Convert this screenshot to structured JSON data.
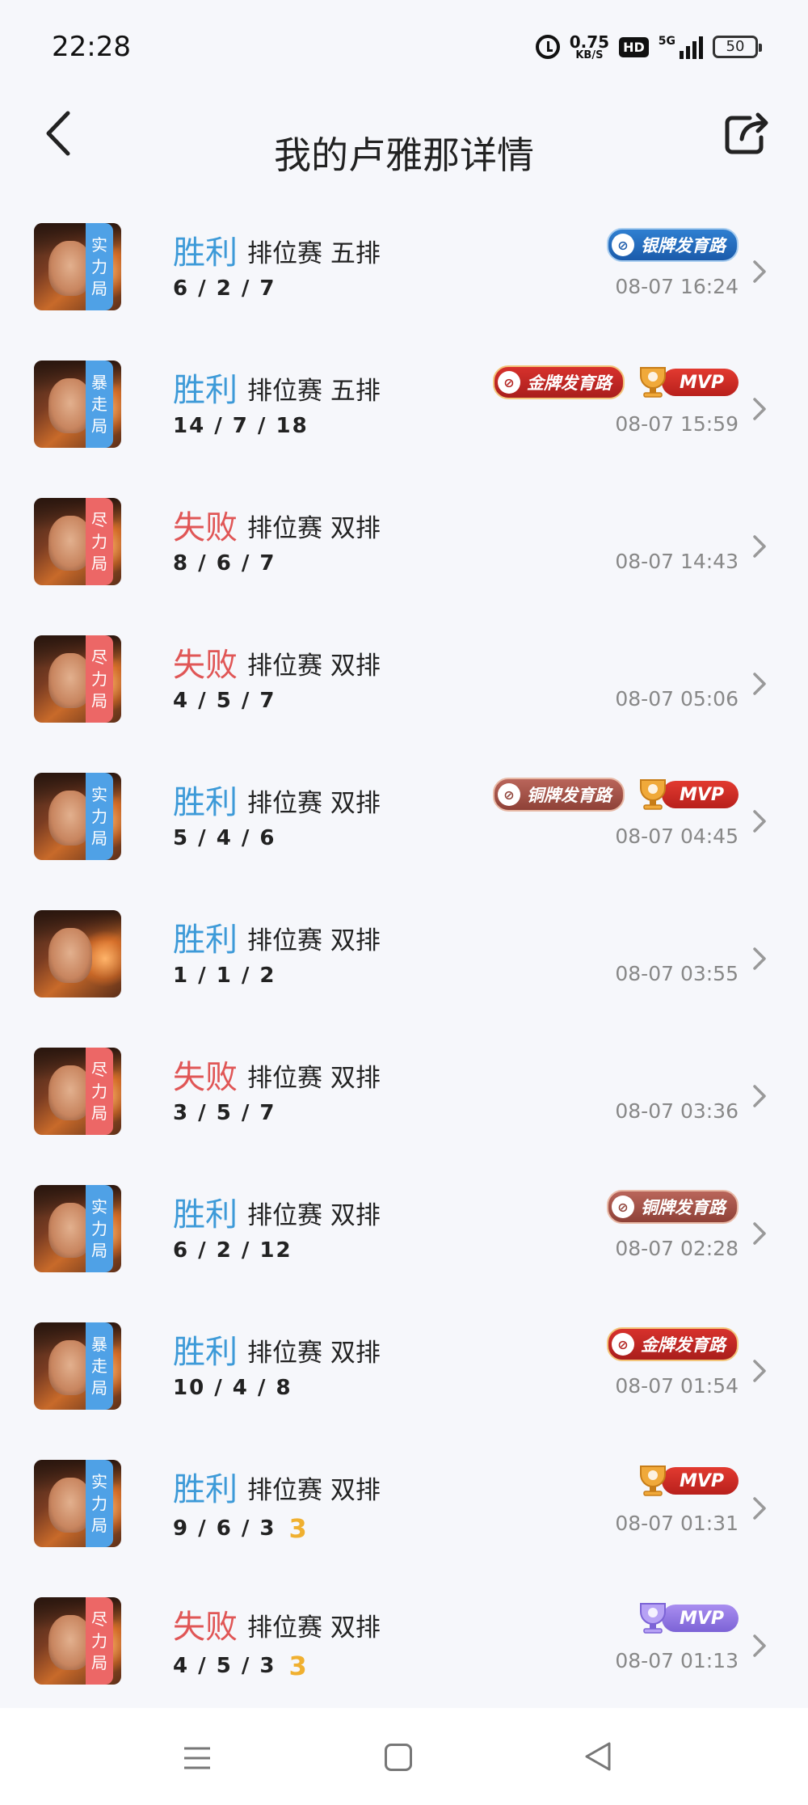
{
  "status": {
    "time": "22:28",
    "speed_value": "0.75",
    "speed_unit": "KB/S",
    "hd": "HD",
    "network": "5G",
    "battery": "50"
  },
  "header": {
    "title": "我的卢雅那详情"
  },
  "icons": {
    "back": "chevron-left-icon",
    "share": "share-icon",
    "row_arrow": "chevron-right-icon",
    "cup": "trophy-icon"
  },
  "colors": {
    "win": "#3d9ad8",
    "loss": "#e05656",
    "tag_blue": "#4fa1e6",
    "tag_red": "#ec6766",
    "extra_number": "#f0b030"
  },
  "matches": [
    {
      "tag": [
        "实",
        "力",
        "局"
      ],
      "tag_color": "blue",
      "result": "胜利",
      "win": true,
      "mode": "排位赛 五排",
      "kda": "6 / 2 / 7",
      "extra": "",
      "badge": {
        "label": "银牌发育路",
        "type": "silver"
      },
      "mvp": null,
      "time": "08-07 16:24"
    },
    {
      "tag": [
        "暴",
        "走",
        "局"
      ],
      "tag_color": "blue",
      "result": "胜利",
      "win": true,
      "mode": "排位赛 五排",
      "kda": "14 / 7 / 18",
      "extra": "",
      "badge": {
        "label": "金牌发育路",
        "type": "gold"
      },
      "mvp": {
        "label": "MVP",
        "type": "red"
      },
      "time": "08-07 15:59"
    },
    {
      "tag": [
        "尽",
        "力",
        "局"
      ],
      "tag_color": "red",
      "result": "失败",
      "win": false,
      "mode": "排位赛 双排",
      "kda": "8 / 6 / 7",
      "extra": "",
      "badge": null,
      "mvp": null,
      "time": "08-07 14:43"
    },
    {
      "tag": [
        "尽",
        "力",
        "局"
      ],
      "tag_color": "red",
      "result": "失败",
      "win": false,
      "mode": "排位赛 双排",
      "kda": "4 / 5 / 7",
      "extra": "",
      "badge": null,
      "mvp": null,
      "time": "08-07 05:06"
    },
    {
      "tag": [
        "实",
        "力",
        "局"
      ],
      "tag_color": "blue",
      "result": "胜利",
      "win": true,
      "mode": "排位赛 双排",
      "kda": "5 / 4 / 6",
      "extra": "",
      "badge": {
        "label": "铜牌发育路",
        "type": "bronze"
      },
      "mvp": {
        "label": "MVP",
        "type": "red"
      },
      "time": "08-07 04:45"
    },
    {
      "tag": null,
      "tag_color": "",
      "result": "胜利",
      "win": true,
      "mode": "排位赛 双排",
      "kda": "1 / 1 / 2",
      "extra": "",
      "badge": null,
      "mvp": null,
      "time": "08-07 03:55"
    },
    {
      "tag": [
        "尽",
        "力",
        "局"
      ],
      "tag_color": "red",
      "result": "失败",
      "win": false,
      "mode": "排位赛 双排",
      "kda": "3 / 5 / 7",
      "extra": "",
      "badge": null,
      "mvp": null,
      "time": "08-07 03:36"
    },
    {
      "tag": [
        "实",
        "力",
        "局"
      ],
      "tag_color": "blue",
      "result": "胜利",
      "win": true,
      "mode": "排位赛 双排",
      "kda": "6 / 2 / 12",
      "extra": "",
      "badge": {
        "label": "铜牌发育路",
        "type": "bronze"
      },
      "mvp": null,
      "time": "08-07 02:28"
    },
    {
      "tag": [
        "暴",
        "走",
        "局"
      ],
      "tag_color": "blue",
      "result": "胜利",
      "win": true,
      "mode": "排位赛 双排",
      "kda": "10 / 4 / 8",
      "extra": "",
      "badge": {
        "label": "金牌发育路",
        "type": "gold"
      },
      "mvp": null,
      "time": "08-07 01:54"
    },
    {
      "tag": [
        "实",
        "力",
        "局"
      ],
      "tag_color": "blue",
      "result": "胜利",
      "win": true,
      "mode": "排位赛 双排",
      "kda": "9 / 6 / 3",
      "extra": "3",
      "badge": null,
      "mvp": {
        "label": "MVP",
        "type": "red"
      },
      "time": "08-07 01:31"
    },
    {
      "tag": [
        "尽",
        "力",
        "局"
      ],
      "tag_color": "red",
      "result": "失败",
      "win": false,
      "mode": "排位赛 双排",
      "kda": "4 / 5 / 3",
      "extra": "3",
      "badge": null,
      "mvp": {
        "label": "MVP",
        "type": "purple"
      },
      "time": "08-07 01:13"
    }
  ],
  "navbar": {
    "menu": "menu-icon",
    "home": "home-square-icon",
    "back": "back-triangle-icon"
  }
}
